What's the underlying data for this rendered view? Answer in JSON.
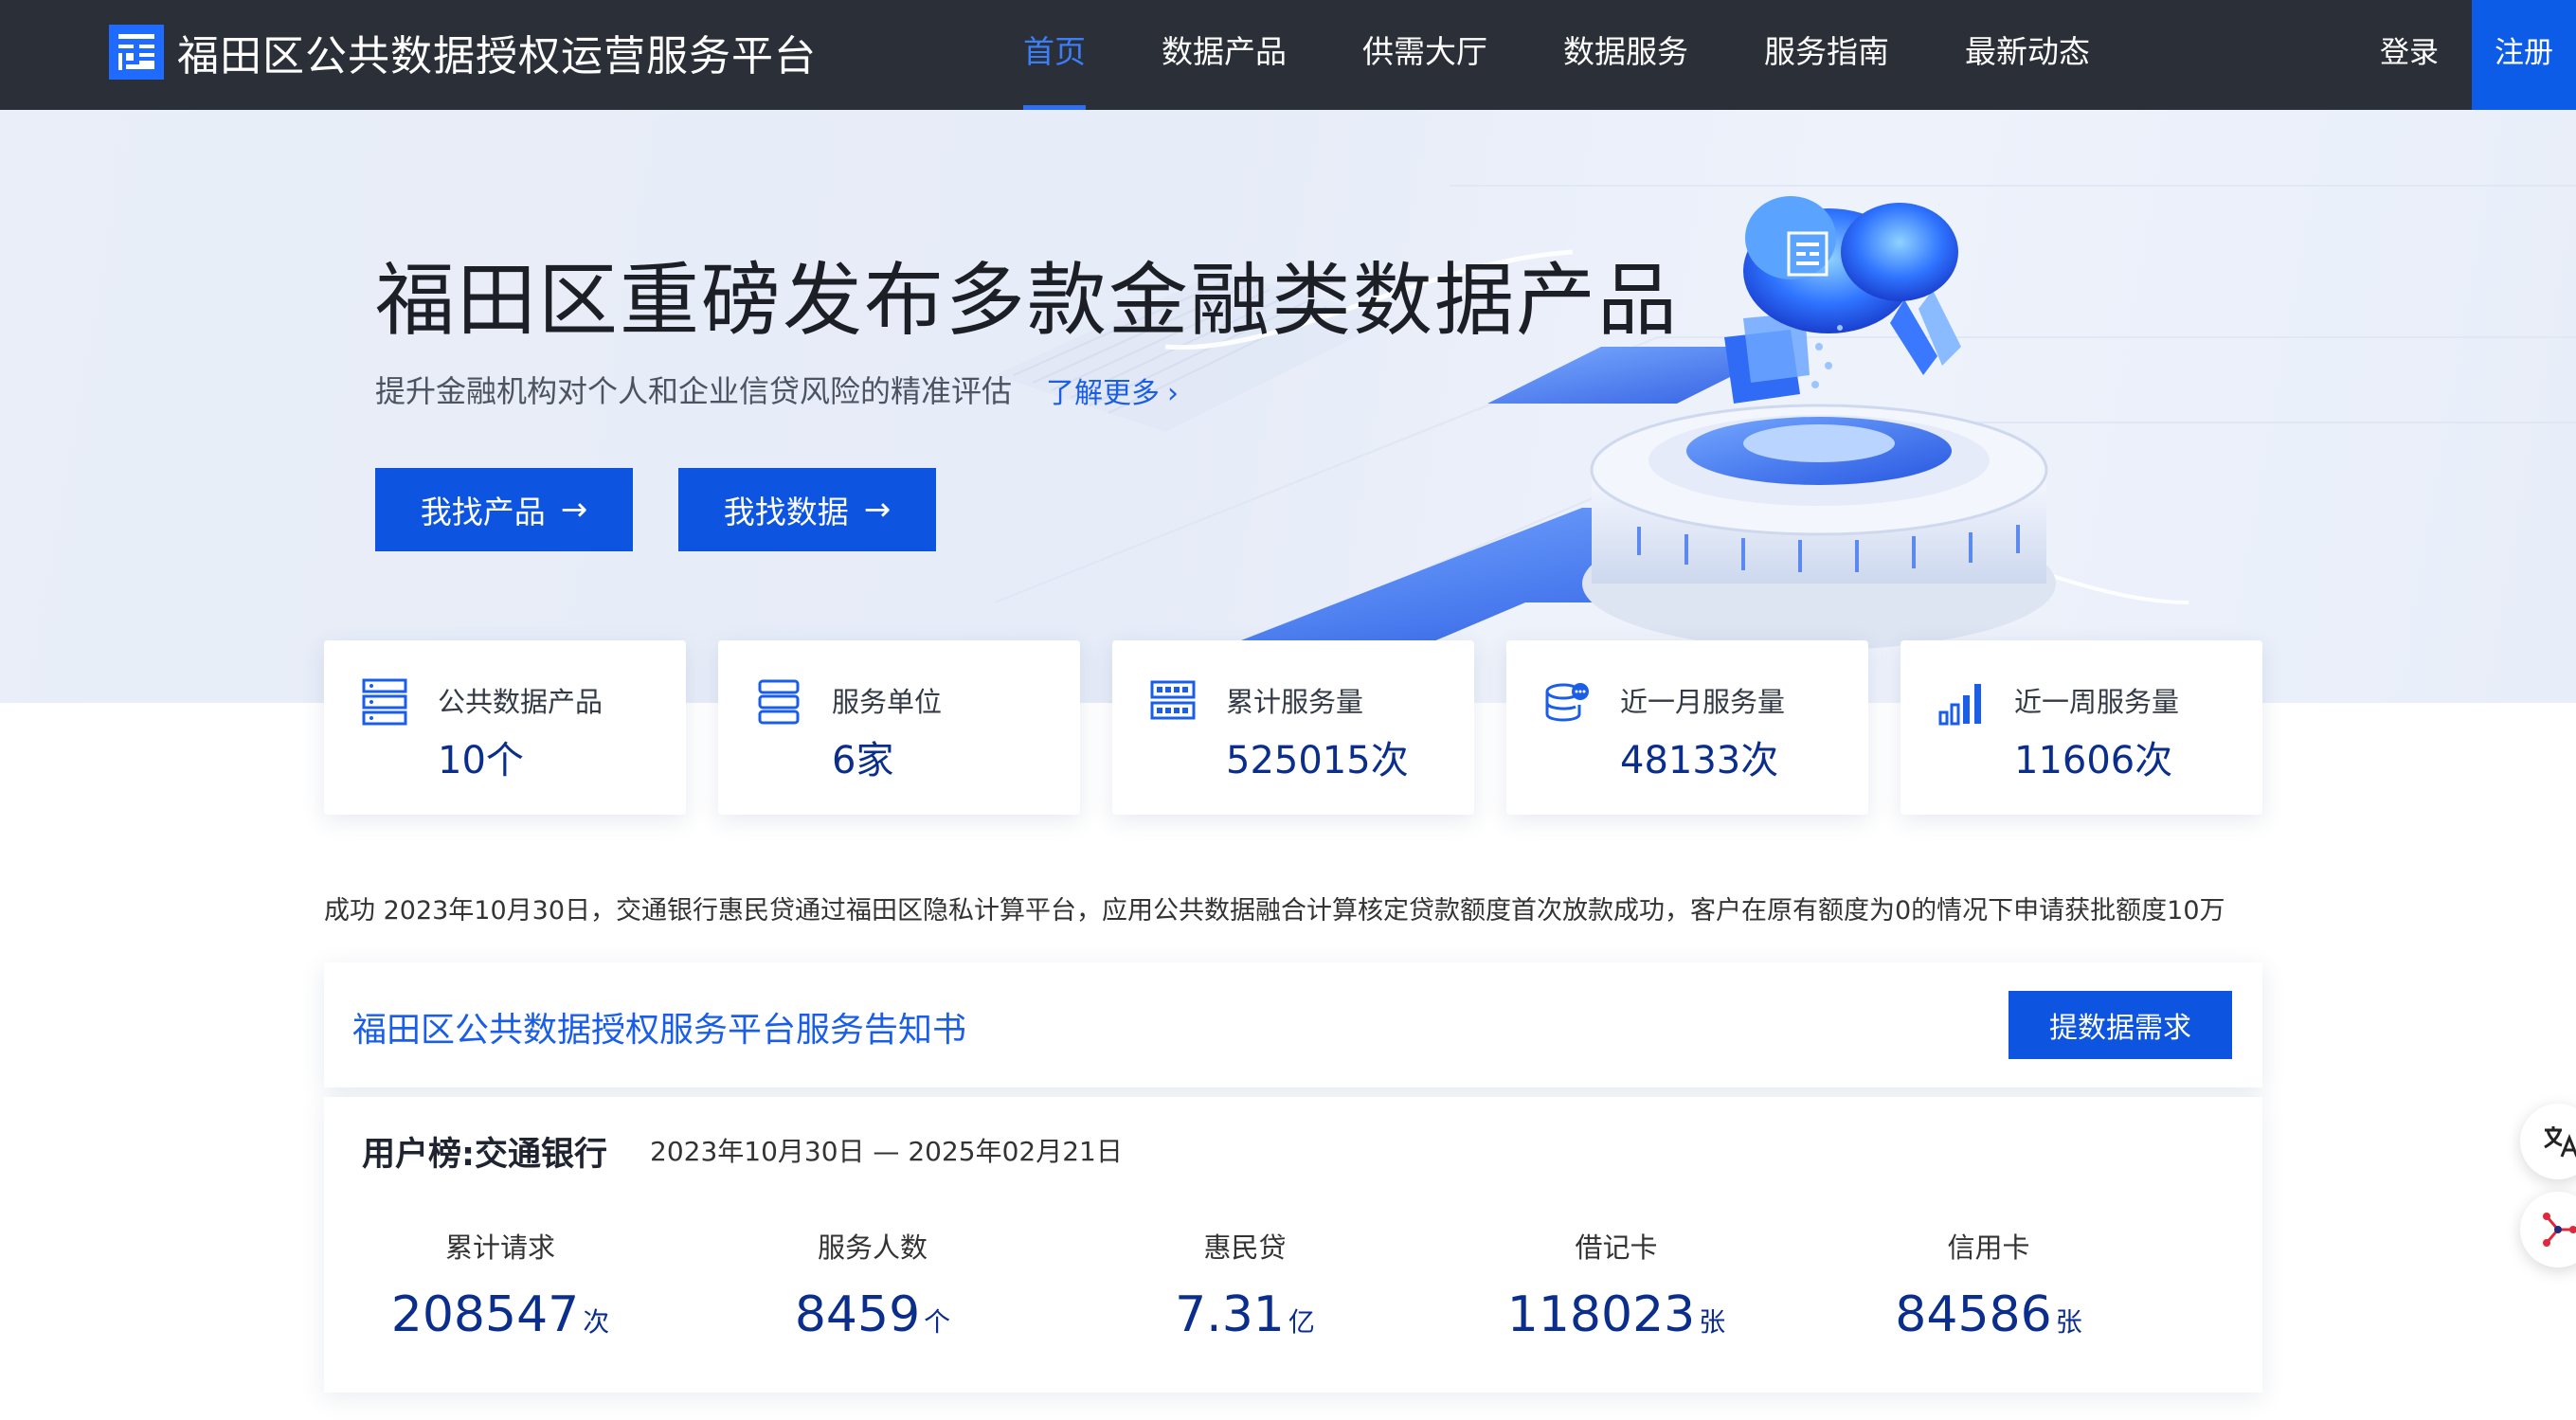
{
  "header": {
    "brand_name": "福田区公共数据授权运营服务平台",
    "nav": [
      "首页",
      "数据产品",
      "供需大厅",
      "数据服务",
      "服务指南",
      "最新动态"
    ],
    "active_nav": "首页",
    "login": "登录",
    "register": "注册"
  },
  "banner": {
    "title": "福田区重磅发布多款金融类数据产品",
    "subtitle": "提升金融机构对个人和企业信贷风险的精准评估",
    "learn_more": "了解更多",
    "btn_find_product": "我找产品",
    "btn_find_data": "我找数据"
  },
  "stats": [
    {
      "icon": "server-rack-icon",
      "label": "公共数据产品",
      "value": "10个"
    },
    {
      "icon": "stack-icon",
      "label": "服务单位",
      "value": "6家"
    },
    {
      "icon": "grid-panel-icon",
      "label": "累计服务量",
      "value": "525015次"
    },
    {
      "icon": "database-chat-icon",
      "label": "近一月服务量",
      "value": "48133次"
    },
    {
      "icon": "signal-bars-icon",
      "label": "近一周服务量",
      "value": "11606次"
    }
  ],
  "ticker": "成功 2023年10月30日，交通银行惠民贷通过福田区隐私计算平台，应用公共数据融合计算核定贷款额度首次放款成功，客户在原有额度为0的情况下申请获批额度10万",
  "notice": {
    "text": "福田区公共数据授权服务平台服务告知书",
    "button": "提数据需求"
  },
  "ranking": {
    "title": "用户榜:交通银行",
    "date_range": "2023年10月30日 — 2025年02月21日",
    "metrics": [
      {
        "label": "累计请求",
        "value": "208547",
        "unit": "次"
      },
      {
        "label": "服务人数",
        "value": "8459",
        "unit": "个"
      },
      {
        "label": "惠民贷",
        "value": "7.31",
        "unit": "亿"
      },
      {
        "label": "借记卡",
        "value": "118023",
        "unit": "张"
      },
      {
        "label": "信用卡",
        "value": "84586",
        "unit": "张"
      }
    ]
  },
  "colors": {
    "topbar": "#2b2f38",
    "primary": "#0d54e0",
    "accent_blue": "#1a5ee8",
    "value_navy": "#0b2e8c"
  }
}
